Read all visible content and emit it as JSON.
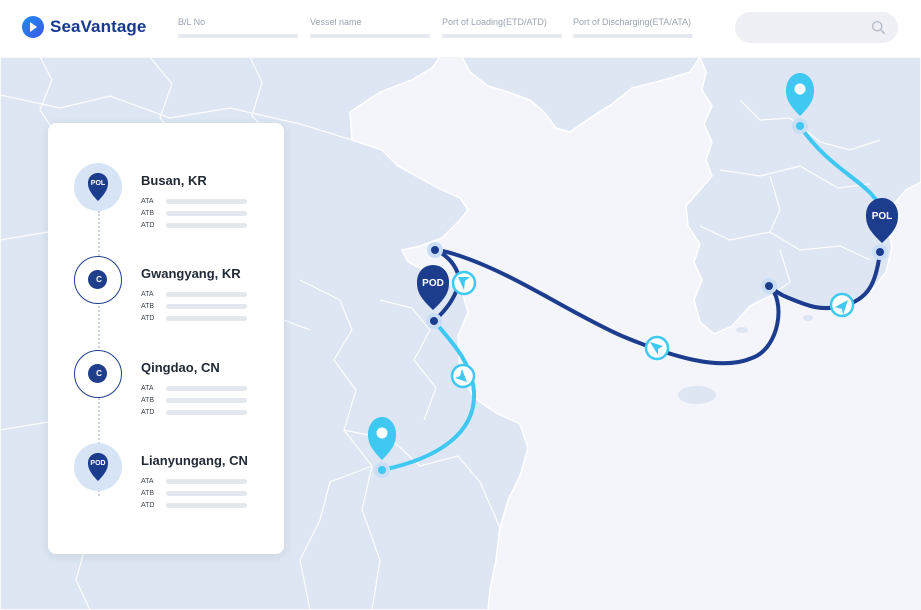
{
  "app": {
    "name": "SeaVantage"
  },
  "header": {
    "fields": [
      {
        "label": "B/L No"
      },
      {
        "label": "Vessel name"
      },
      {
        "label": "Port of Loading(ETD/ATD)"
      },
      {
        "label": "Port of Discharging(ETA/ATA)"
      }
    ],
    "search": {
      "icon": "search-icon"
    }
  },
  "colors": {
    "brand": "#17388e",
    "route_navy": "#1c3c8e",
    "route_cyan": "#3ec8f2",
    "land": "#dde6f2",
    "sea": "#f3f5fa",
    "pin_badge_bg": "#d6e4f6"
  },
  "map": {
    "pins": [
      {
        "label": "POL",
        "color": "#1c3c8e"
      },
      {
        "label": "POD",
        "color": "#1c3c8e"
      }
    ]
  },
  "stops": [
    {
      "name": "Busan, KR",
      "badge": "POL",
      "badge_type": "pin",
      "rows": [
        "ATA",
        "ATB",
        "ATD"
      ]
    },
    {
      "name": "Gwangyang, KR",
      "badge": "C",
      "badge_type": "circle",
      "rows": [
        "ATA",
        "ATB",
        "ATD"
      ]
    },
    {
      "name": "Qingdao, CN",
      "badge": "C",
      "badge_type": "circle",
      "rows": [
        "ATA",
        "ATB",
        "ATD"
      ]
    },
    {
      "name": "Lianyungang, CN",
      "badge": "POD",
      "badge_type": "pin",
      "rows": [
        "ATA",
        "ATB",
        "ATD"
      ]
    }
  ]
}
